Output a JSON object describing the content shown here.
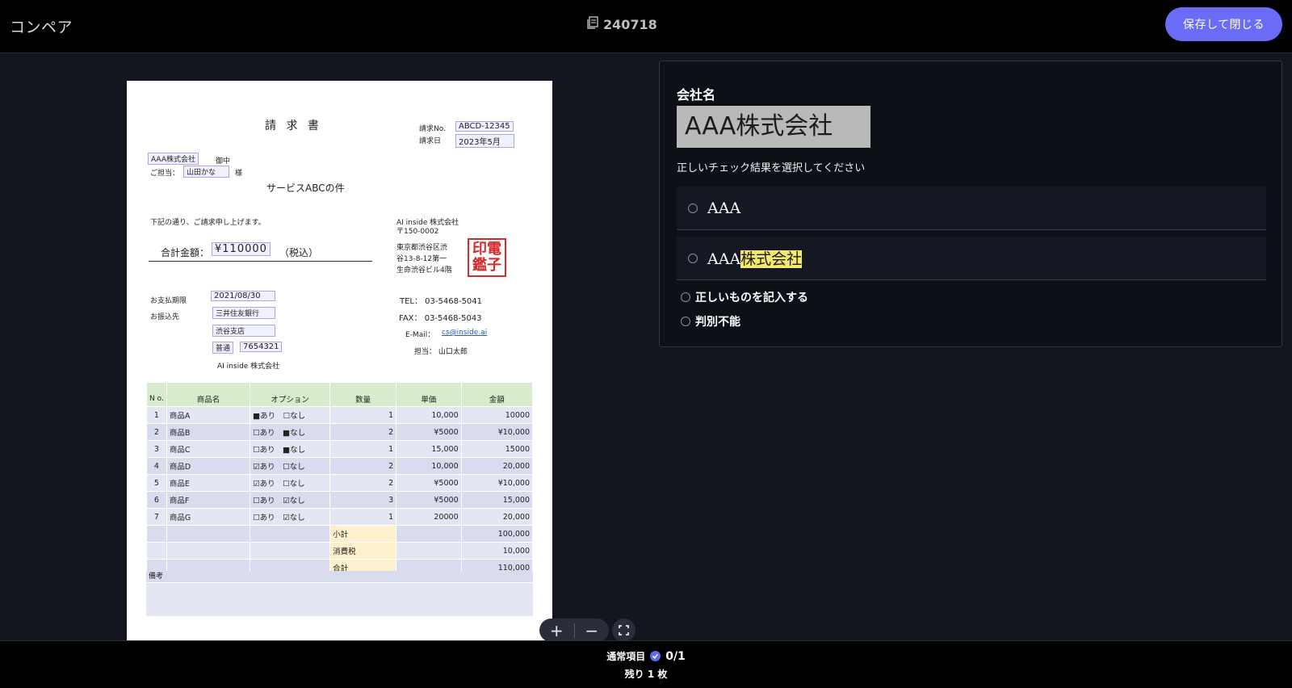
{
  "header": {
    "app_title": "コンペア",
    "doc_id": "240718",
    "doc_icon": "stack-document-icon",
    "save_label": "保存して閉じる"
  },
  "invoice": {
    "title": "請 求 書",
    "no_label": "請求No.",
    "no_value": "ABCD-12345",
    "date_label": "請求日",
    "date_value": "2023年5月",
    "company": "AAA株式会社",
    "honorific": "御中",
    "contact_label": "ご担当：",
    "contact_name": "山田かな",
    "contact_suffix": "様",
    "subject": "サービスABCの件",
    "greeting": "下記の通り、ご請求申し上げます。",
    "total_label": "合計金額：",
    "total_value": "¥110000",
    "tax_note": "（税込）",
    "issuer_name": "AI inside 株式会社",
    "issuer_zip": "〒150-0002",
    "issuer_addr1": "東京都渋谷区渋",
    "issuer_addr2": "谷13-8-12第一",
    "issuer_addr3": "生命渋谷ビル4階",
    "stamp_line1": "印電",
    "stamp_line2": "鑑子",
    "due_label": "お支払期限",
    "due_value": "2021/08/30",
    "bank_label": "お振込先",
    "bank_name": "三井住友銀行",
    "branch": "渋谷支店",
    "account_type": "普通",
    "account_no": "7654321",
    "account_holder": "AI inside 株式会社",
    "tel": "TEL： 03-5468-5041",
    "fax": "FAX： 03-5468-5043",
    "email_label": "E-Mail：",
    "email": "cs@inside.ai",
    "staff": "担当： 山口太郎",
    "table_headers": [
      "N o.",
      "商品名",
      "オプション",
      "数量",
      "単価",
      "金額"
    ],
    "rows": [
      [
        "1",
        "商品A",
        "■あり　☐なし",
        "1",
        "10,000",
        "10000"
      ],
      [
        "2",
        "商品B",
        "☐あり　■なし",
        "2",
        "¥5000",
        "¥10,000"
      ],
      [
        "3",
        "商品C",
        "☐あり　■なし",
        "1",
        "15,000",
        "15000"
      ],
      [
        "4",
        "商品D",
        "☑あり　☐なし",
        "2",
        "10,000",
        "20,000"
      ],
      [
        "5",
        "商品E",
        "☑あり　☐なし",
        "2",
        "¥5000",
        "¥10,000"
      ],
      [
        "6",
        "商品F",
        "☐あり　☑なし",
        "3",
        "¥5000",
        "15,000"
      ],
      [
        "7",
        "商品G",
        "☐あり　☑なし",
        "1",
        "20000",
        "20,000"
      ]
    ],
    "summary": [
      [
        "小計",
        "100,000"
      ],
      [
        "消費税",
        "10,000"
      ],
      [
        "合計",
        "110,000"
      ]
    ],
    "memo_label": "備考"
  },
  "zoom": {
    "zoom_in": "+",
    "zoom_out": "−"
  },
  "panel": {
    "field_label": "会社名",
    "crop_text": "AAA株式会社",
    "instruction": "正しいチェック結果を選択してください",
    "option1": "AAA",
    "option2_prefix": "AAA",
    "option2_highlight": "株式会社",
    "option3": "正しいものを記入する",
    "option4": "判別不能"
  },
  "footer": {
    "category": "通常項目",
    "progress": "0/1",
    "remaining": "残り 1 枚"
  },
  "colors": {
    "accent": "#6a6cf6",
    "highlight": "#f5e871"
  }
}
